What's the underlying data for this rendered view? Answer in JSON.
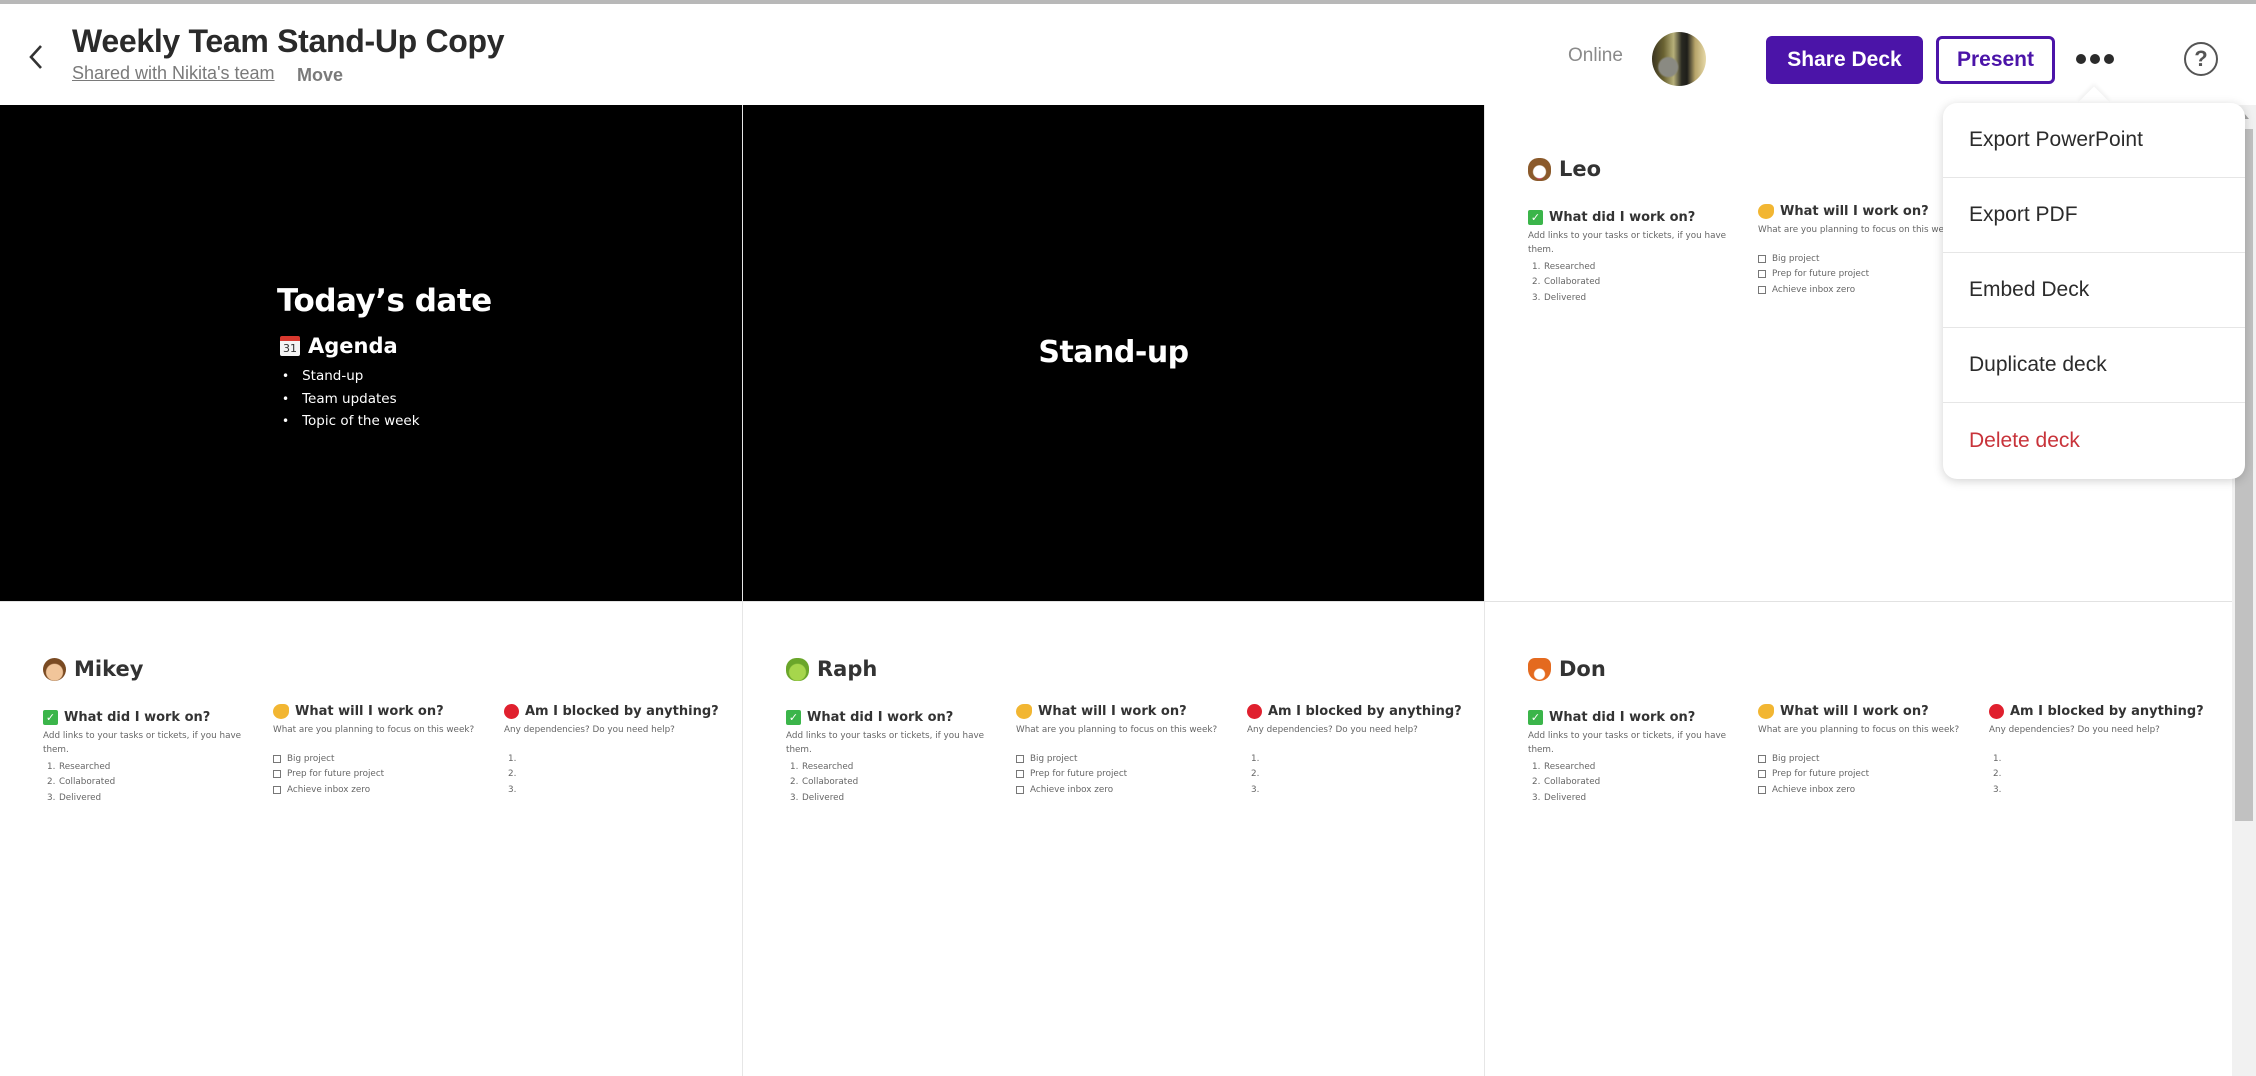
{
  "header": {
    "title": "Weekly Team Stand-Up Copy",
    "shared_label": "Shared with Nikita's team",
    "move_label": "Move",
    "status": "Online",
    "share_button": "Share Deck",
    "present_button": "Present",
    "help_glyph": "?",
    "icons": {
      "back": "chevron-left-icon",
      "more": "more-horizontal-icon",
      "help": "help-circle-icon"
    }
  },
  "colors": {
    "brand": "#4b14a8",
    "danger": "#c8333a"
  },
  "menu": {
    "items": [
      {
        "label": "Export PowerPoint"
      },
      {
        "label": "Export PDF"
      },
      {
        "label": "Embed Deck"
      },
      {
        "label": "Duplicate deck"
      },
      {
        "label": "Delete deck",
        "danger": true
      }
    ]
  },
  "slides": {
    "intro": {
      "title": "Today’s date",
      "agenda_icon": "31",
      "agenda_title": "Agenda",
      "agenda_items": [
        "Stand-up",
        "Team updates",
        "Topic of the week"
      ]
    },
    "section": {
      "title": "Stand-up"
    },
    "people": [
      {
        "name": "Leo",
        "emoji": "dog-face"
      },
      {
        "name": "Mikey",
        "emoji": "monkey-face"
      },
      {
        "name": "Raph",
        "emoji": "frog-face"
      },
      {
        "name": "Don",
        "emoji": "fox-face"
      }
    ],
    "did": {
      "title": "What did I work on?",
      "subtitle": "Add links to your tasks or tickets, if you have them.",
      "items": [
        "Researched",
        "Collaborated",
        "Delivered"
      ],
      "numbers": [
        "1.",
        "2.",
        "3."
      ]
    },
    "will": {
      "title": "What will I work on?",
      "subtitle": "What are you planning to focus on this week?",
      "items": [
        "Big project",
        "Prep for future project",
        "Achieve inbox zero"
      ]
    },
    "blocked": {
      "title": "Am I blocked by anything?",
      "subtitle": "Any dependencies? Do you need help?",
      "numbers": [
        "1.",
        "2.",
        "3."
      ]
    }
  }
}
